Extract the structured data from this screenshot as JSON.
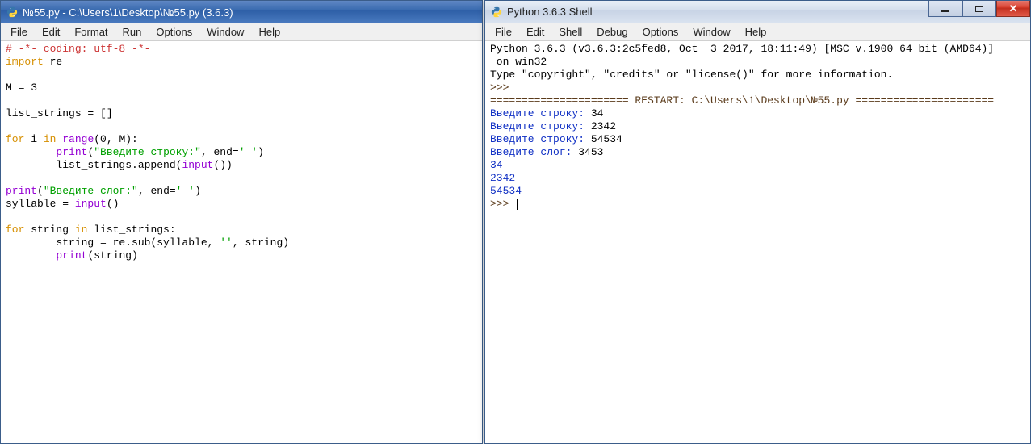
{
  "editor": {
    "title": "№55.py - C:\\Users\\1\\Desktop\\№55.py (3.6.3)",
    "menu": [
      "File",
      "Edit",
      "Format",
      "Run",
      "Options",
      "Window",
      "Help"
    ],
    "code": [
      {
        "segs": [
          {
            "cls": "c-comment",
            "t": "# -*- coding: utf-8 -*-"
          }
        ]
      },
      {
        "segs": [
          {
            "cls": "c-kw",
            "t": "import"
          },
          {
            "cls": "c-default",
            "t": " re"
          }
        ]
      },
      {
        "segs": [
          {
            "cls": "c-default",
            "t": ""
          }
        ]
      },
      {
        "segs": [
          {
            "cls": "c-default",
            "t": "M = 3"
          }
        ]
      },
      {
        "segs": [
          {
            "cls": "c-default",
            "t": ""
          }
        ]
      },
      {
        "segs": [
          {
            "cls": "c-default",
            "t": "list_strings = []"
          }
        ]
      },
      {
        "segs": [
          {
            "cls": "c-default",
            "t": ""
          }
        ]
      },
      {
        "segs": [
          {
            "cls": "c-kw",
            "t": "for"
          },
          {
            "cls": "c-default",
            "t": " i "
          },
          {
            "cls": "c-kw",
            "t": "in"
          },
          {
            "cls": "c-default",
            "t": " "
          },
          {
            "cls": "c-builtin",
            "t": "range"
          },
          {
            "cls": "c-default",
            "t": "(0, M):"
          }
        ]
      },
      {
        "segs": [
          {
            "cls": "c-default",
            "t": "        "
          },
          {
            "cls": "c-builtin",
            "t": "print"
          },
          {
            "cls": "c-default",
            "t": "("
          },
          {
            "cls": "c-str",
            "t": "\"Введите строку:\""
          },
          {
            "cls": "c-default",
            "t": ", end="
          },
          {
            "cls": "c-str",
            "t": "' '"
          },
          {
            "cls": "c-default",
            "t": ")"
          }
        ]
      },
      {
        "segs": [
          {
            "cls": "c-default",
            "t": "        list_strings.append("
          },
          {
            "cls": "c-builtin",
            "t": "input"
          },
          {
            "cls": "c-default",
            "t": "())"
          }
        ]
      },
      {
        "segs": [
          {
            "cls": "c-default",
            "t": ""
          }
        ]
      },
      {
        "segs": [
          {
            "cls": "c-builtin",
            "t": "print"
          },
          {
            "cls": "c-default",
            "t": "("
          },
          {
            "cls": "c-str",
            "t": "\"Введите слог:\""
          },
          {
            "cls": "c-default",
            "t": ", end="
          },
          {
            "cls": "c-str",
            "t": "' '"
          },
          {
            "cls": "c-default",
            "t": ")"
          }
        ]
      },
      {
        "segs": [
          {
            "cls": "c-default",
            "t": "syllable = "
          },
          {
            "cls": "c-builtin",
            "t": "input"
          },
          {
            "cls": "c-default",
            "t": "()"
          }
        ]
      },
      {
        "segs": [
          {
            "cls": "c-default",
            "t": ""
          }
        ]
      },
      {
        "segs": [
          {
            "cls": "c-kw",
            "t": "for"
          },
          {
            "cls": "c-default",
            "t": " string "
          },
          {
            "cls": "c-kw",
            "t": "in"
          },
          {
            "cls": "c-default",
            "t": " list_strings:"
          }
        ]
      },
      {
        "segs": [
          {
            "cls": "c-default",
            "t": "        string = re.sub(syllable, "
          },
          {
            "cls": "c-str",
            "t": "''"
          },
          {
            "cls": "c-default",
            "t": ", string)"
          }
        ]
      },
      {
        "segs": [
          {
            "cls": "c-default",
            "t": "        "
          },
          {
            "cls": "c-builtin",
            "t": "print"
          },
          {
            "cls": "c-default",
            "t": "(string)"
          }
        ]
      }
    ]
  },
  "shell": {
    "title": "Python 3.6.3 Shell",
    "menu": [
      "File",
      "Edit",
      "Shell",
      "Debug",
      "Options",
      "Window",
      "Help"
    ],
    "lines": [
      {
        "segs": [
          {
            "cls": "s-banner",
            "t": "Python 3.6.3 (v3.6.3:2c5fed8, Oct  3 2017, 18:11:49) [MSC v.1900 64 bit (AMD64)]"
          }
        ]
      },
      {
        "segs": [
          {
            "cls": "s-banner",
            "t": " on win32"
          }
        ]
      },
      {
        "segs": [
          {
            "cls": "s-banner",
            "t": "Type \"copyright\", \"credits\" or \"license()\" for more information."
          }
        ]
      },
      {
        "segs": [
          {
            "cls": "s-prompt",
            "t": ">>> "
          }
        ]
      },
      {
        "segs": [
          {
            "cls": "s-prompt",
            "t": "====================== RESTART: C:\\Users\\1\\Desktop\\№55.py ======================"
          }
        ]
      },
      {
        "segs": [
          {
            "cls": "s-out",
            "t": "Введите строку:"
          },
          {
            "cls": "s-banner",
            "t": " 34"
          }
        ]
      },
      {
        "segs": [
          {
            "cls": "s-out",
            "t": "Введите строку:"
          },
          {
            "cls": "s-banner",
            "t": " 2342"
          }
        ]
      },
      {
        "segs": [
          {
            "cls": "s-out",
            "t": "Введите строку:"
          },
          {
            "cls": "s-banner",
            "t": " 54534"
          }
        ]
      },
      {
        "segs": [
          {
            "cls": "s-out",
            "t": "Введите слог:"
          },
          {
            "cls": "s-banner",
            "t": " 3453"
          }
        ]
      },
      {
        "segs": [
          {
            "cls": "s-out",
            "t": "34"
          }
        ]
      },
      {
        "segs": [
          {
            "cls": "s-out",
            "t": "2342"
          }
        ]
      },
      {
        "segs": [
          {
            "cls": "s-out",
            "t": "54534"
          }
        ]
      },
      {
        "segs": [
          {
            "cls": "s-prompt",
            "t": ">>> "
          }
        ],
        "cursor": true
      }
    ],
    "controls": {
      "min": "_",
      "max": "□",
      "close": "✕"
    }
  }
}
